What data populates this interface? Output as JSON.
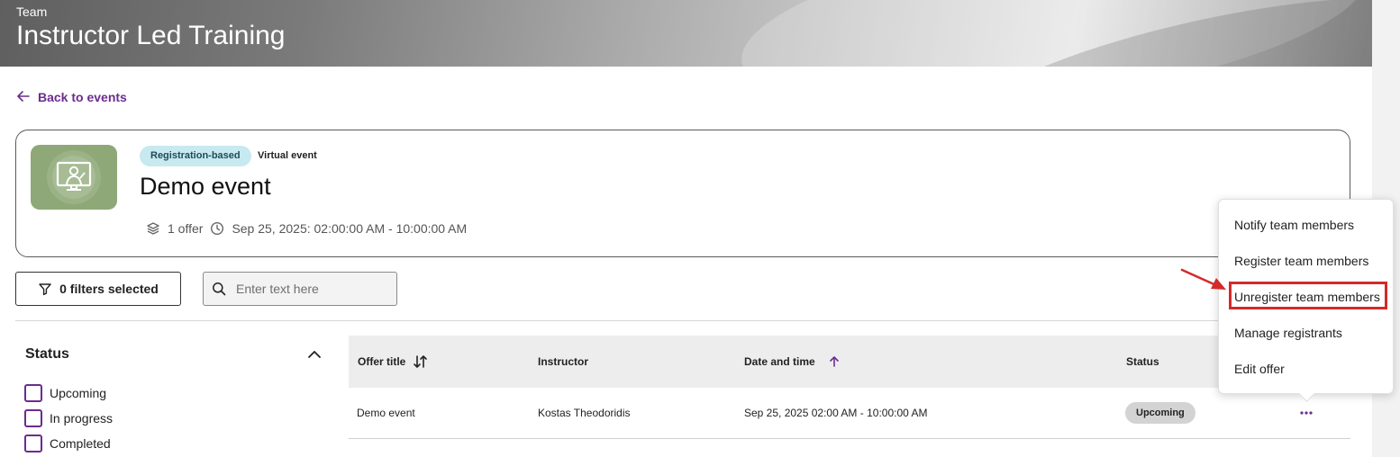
{
  "header": {
    "eyebrow": "Team",
    "title": "Instructor Led Training"
  },
  "back_link": {
    "label": "Back to events"
  },
  "event": {
    "badge_type": "Registration-based",
    "badge_delivery": "Virtual event",
    "title": "Demo event",
    "offers": "1 offer",
    "schedule": "Sep 25, 2025: 02:00:00 AM - 10:00:00 AM"
  },
  "toolbar": {
    "filters_label": "0 filters selected",
    "search_placeholder": "Enter text here"
  },
  "filter_panel": {
    "heading": "Status",
    "options": [
      "Upcoming",
      "In progress",
      "Completed"
    ]
  },
  "table": {
    "columns": [
      "Offer title",
      "Instructor",
      "Date and time",
      "Status"
    ],
    "rows": [
      {
        "offer_title": "Demo event",
        "instructor": "Kostas Theodoridis",
        "date_time": "Sep 25, 2025 02:00 AM - 10:00:00 AM",
        "status": "Upcoming"
      }
    ]
  },
  "menu": {
    "items": [
      "Notify team members",
      "Register team members",
      "Unregister team members",
      "Manage registrants",
      "Edit offer"
    ],
    "highlighted": "Unregister team members"
  },
  "colors": {
    "accent": "#6b2c8f",
    "badge_bg": "#c7e9f0",
    "highlight": "#d42a2a",
    "thumb_bg": "#8ea877"
  },
  "icons": {
    "back": "arrow-left-icon",
    "offers": "layers-icon",
    "time": "clock-icon",
    "filter": "funnel-icon",
    "search": "search-icon",
    "collapse": "chevron-up-icon",
    "sort": "sort-arrows-icon",
    "sort_asc": "arrow-up-icon",
    "more": "more-horizontal-icon"
  }
}
